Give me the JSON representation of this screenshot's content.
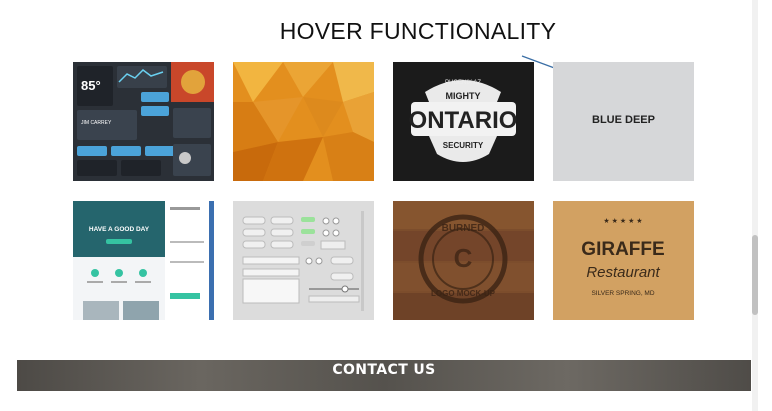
{
  "annotation": {
    "text": "HOVER FUNCTIONALITY"
  },
  "gallery": {
    "tiles": [
      {
        "name": "dashboard-ui-kit",
        "label": ""
      },
      {
        "name": "orange-polygon",
        "label": ""
      },
      {
        "name": "ontario-badge",
        "label": "",
        "badge_top": "PHOENIX AZ",
        "badge_line1": "MIGHTY",
        "badge_line2": "ONTARIO",
        "badge_line3": "SECURITY"
      },
      {
        "name": "hovered-tile",
        "label": "BLUE DEEP"
      },
      {
        "name": "landing-page-mockup",
        "label": "",
        "hero": "HAVE A GOOD DAY"
      },
      {
        "name": "ui-controls-kit",
        "label": ""
      },
      {
        "name": "burned-logo-mockup",
        "label": "",
        "stamp_top": "BURNED",
        "stamp_bottom": "LOGO MOCK-UP"
      },
      {
        "name": "giraffe-restaurant",
        "label": "",
        "line1": "GIRAFFE",
        "line2": "Restaurant",
        "line3": "SILVER SPRING, MD"
      }
    ]
  },
  "contact": {
    "label": "CONTACT US"
  },
  "colors": {
    "accent_arrow": "#3a6ea5",
    "hover_bg": "#d6d7d9",
    "footer_bg": "#5a5752"
  }
}
